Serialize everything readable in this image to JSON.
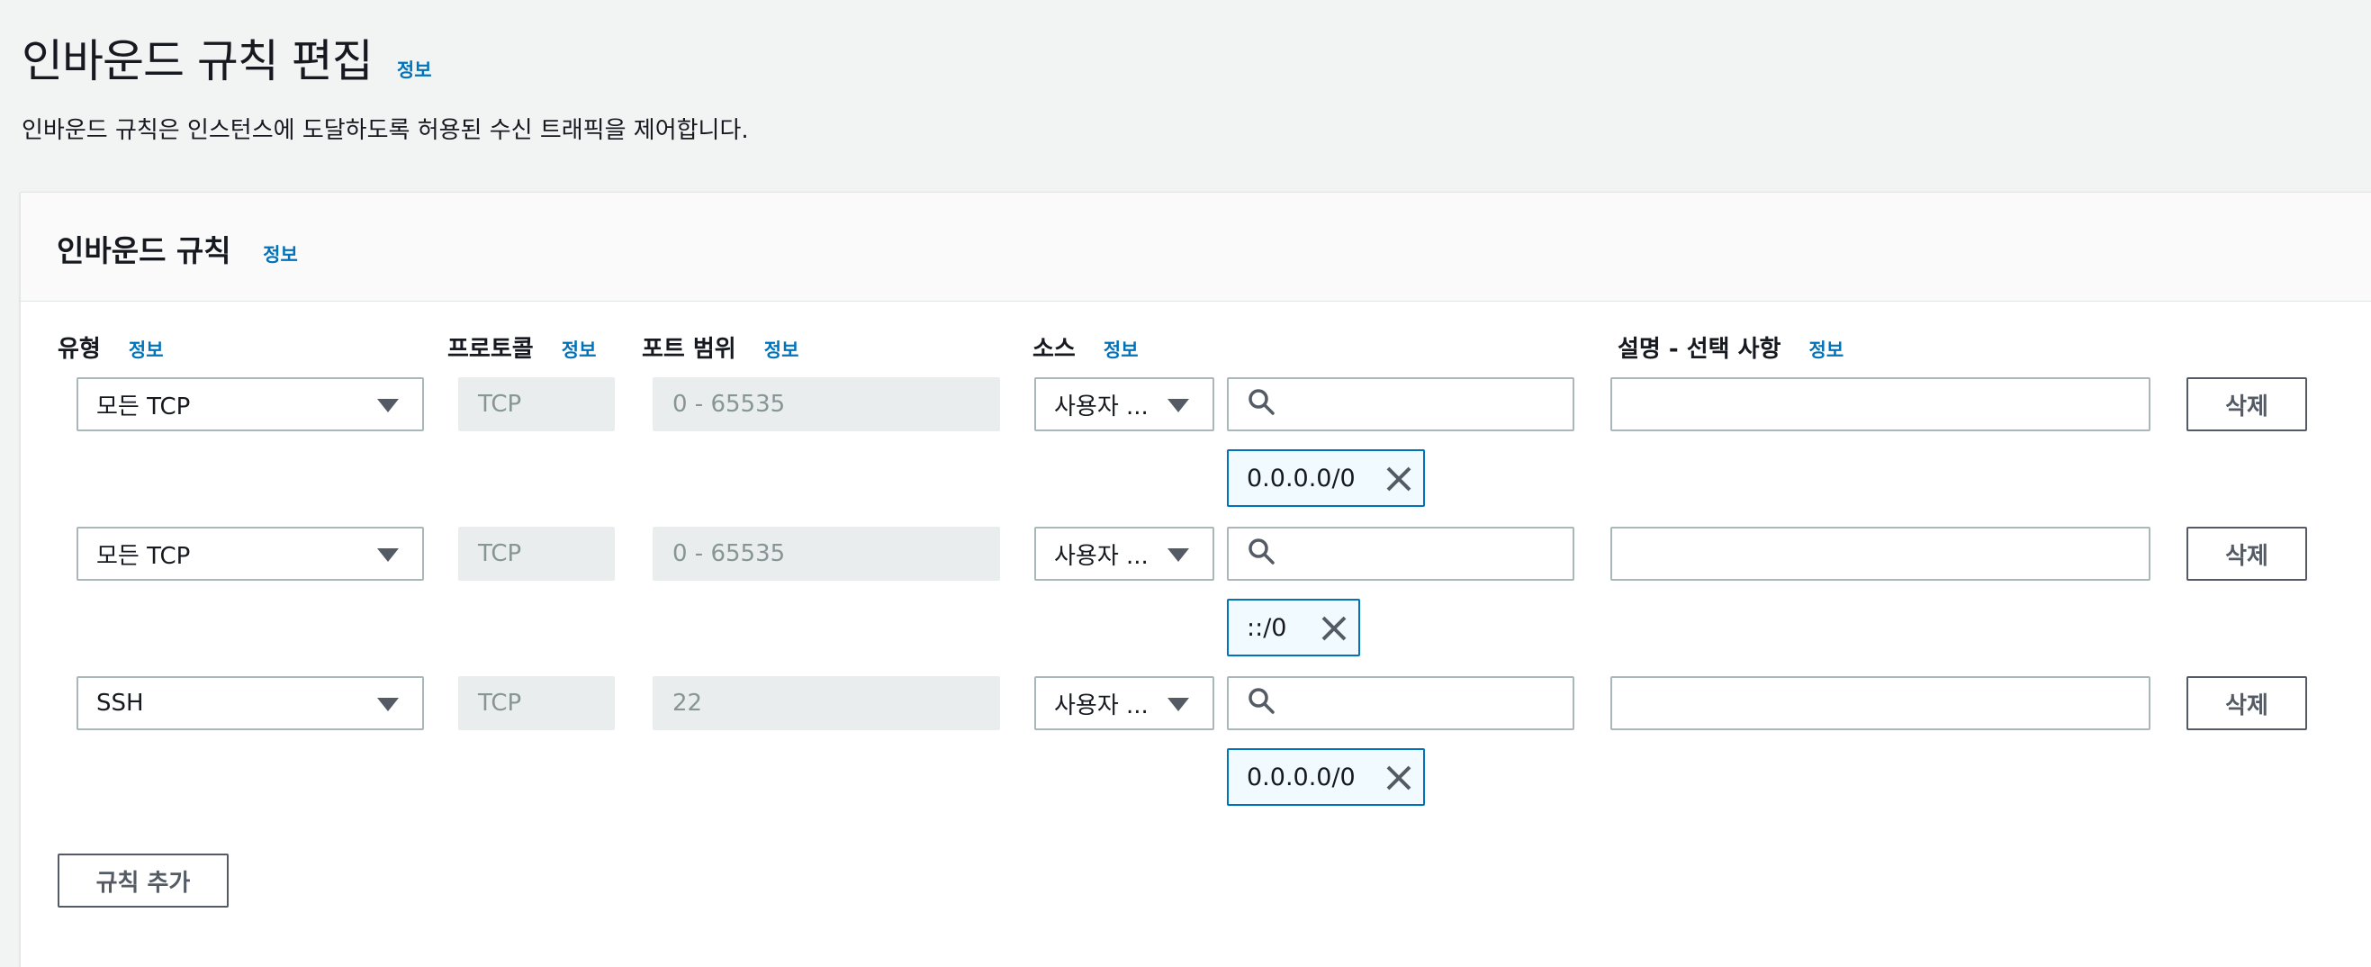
{
  "page": {
    "title": "인바운드 규칙 편집",
    "info": "정보",
    "description": "인바운드 규칙은 인스턴스에 도달하도록 허용된 수신 트래픽을 제어합니다."
  },
  "panel": {
    "title": "인바운드 규칙",
    "info": "정보"
  },
  "columns": {
    "type": "유형",
    "protocol": "프로토콜",
    "port_range": "포트 범위",
    "source": "소스",
    "description": "설명 - 선택 사항",
    "info": "정보"
  },
  "rules": [
    {
      "type": "모든 TCP",
      "protocol": "TCP",
      "port_range": "0 - 65535",
      "source_type": "사용자 ...",
      "source_search": "",
      "cidr": "0.0.0.0/0",
      "description": "",
      "delete": "삭제"
    },
    {
      "type": "모든 TCP",
      "protocol": "TCP",
      "port_range": "0 - 65535",
      "source_type": "사용자 ...",
      "source_search": "",
      "cidr": "::/0",
      "description": "",
      "delete": "삭제"
    },
    {
      "type": "SSH",
      "protocol": "TCP",
      "port_range": "22",
      "source_type": "사용자 ...",
      "source_search": "",
      "cidr": "0.0.0.0/0",
      "description": "",
      "delete": "삭제"
    }
  ],
  "add_rule": "규칙 추가",
  "icons": {
    "search": "search-icon",
    "remove": "close-icon",
    "dropdown": "caret-down-icon"
  },
  "colors": {
    "link": "#0073bb",
    "token_border": "#0073bb",
    "token_bg": "#f1faff",
    "disabled_bg": "#eaeded"
  }
}
